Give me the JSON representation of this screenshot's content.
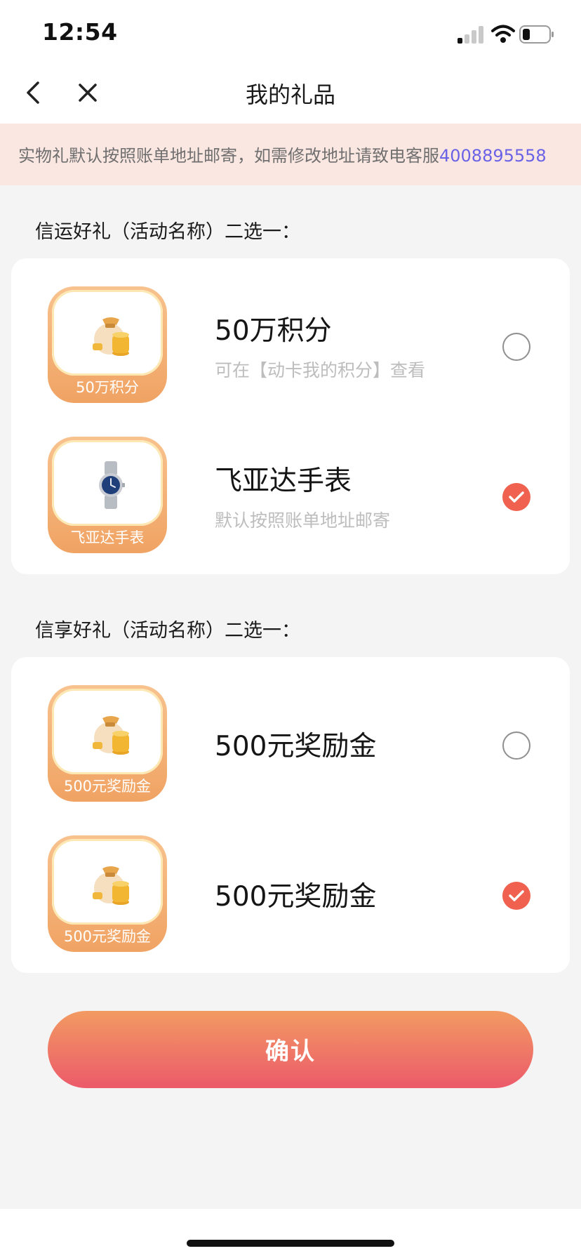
{
  "status_bar": {
    "time": "12:54"
  },
  "nav": {
    "title": "我的礼品",
    "back_icon": "chevron-left-icon",
    "close_icon": "close-icon"
  },
  "notice": {
    "text": "实物礼默认按照账单地址邮寄，如需修改地址请致电客服",
    "phone": "4008895558"
  },
  "groups": [
    {
      "title": "信运好礼（活动名称）二选一：",
      "options": [
        {
          "thumb_label": "50万积分",
          "icon": "coin-bag-icon",
          "name": "50万积分",
          "desc": "可在【动卡我的积分】查看",
          "selected": false
        },
        {
          "thumb_label": "飞亚达手表",
          "icon": "watch-icon",
          "name": "飞亚达手表",
          "desc": "默认按照账单地址邮寄",
          "selected": true
        }
      ]
    },
    {
      "title": "信享好礼（活动名称）二选一：",
      "options": [
        {
          "thumb_label": "500元奖励金",
          "icon": "coin-bag-icon",
          "name": "500元奖励金",
          "desc": "",
          "selected": false
        },
        {
          "thumb_label": "500元奖励金",
          "icon": "coin-bag-icon",
          "name": "500元奖励金",
          "desc": "",
          "selected": true
        }
      ]
    }
  ],
  "confirm_label": "确认",
  "colors": {
    "accent": "#f0624f",
    "notice_bg": "#fbe7e1",
    "phone_link": "#6a62e6",
    "button_top": "#f29a62",
    "button_bottom": "#ec5a6a"
  }
}
